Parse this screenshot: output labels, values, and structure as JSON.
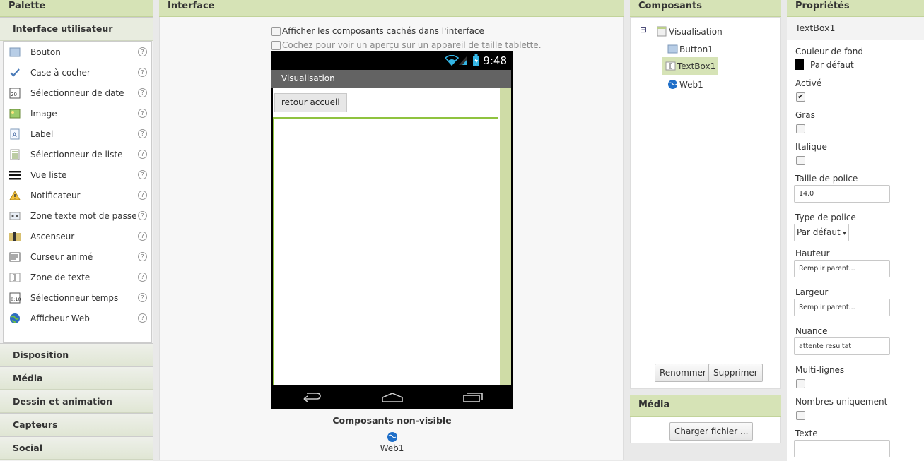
{
  "palette": {
    "title": "Palette",
    "open_section": "Interface utilisateur",
    "items": [
      {
        "label": "Bouton",
        "icon": "button-icon"
      },
      {
        "label": "Case à cocher",
        "icon": "checkbox-icon"
      },
      {
        "label": "Sélectionneur de date",
        "icon": "calendar-icon"
      },
      {
        "label": "Image",
        "icon": "image-icon"
      },
      {
        "label": "Label",
        "icon": "label-icon"
      },
      {
        "label": "Sélectionneur de liste",
        "icon": "list-picker-icon"
      },
      {
        "label": "Vue liste",
        "icon": "list-view-icon"
      },
      {
        "label": "Notificateur",
        "icon": "warning-icon"
      },
      {
        "label": "Zone texte mot de passe",
        "icon": "password-icon"
      },
      {
        "label": "Ascenseur",
        "icon": "slider-icon"
      },
      {
        "label": "Curseur animé",
        "icon": "spinner-icon"
      },
      {
        "label": "Zone de texte",
        "icon": "textbox-icon"
      },
      {
        "label": "Sélectionneur temps",
        "icon": "clock-icon"
      },
      {
        "label": "Afficheur Web",
        "icon": "globe-icon"
      }
    ],
    "help_glyph": "?",
    "sections": [
      "Disposition",
      "Média",
      "Dessin et animation",
      "Capteurs",
      "Social"
    ]
  },
  "interface": {
    "title": "Interface",
    "show_hidden": "Afficher les composants cachés dans l'interface",
    "tablet_preview": "Cochez pour voir un aperçu sur un appareil de taille tablette.",
    "phone": {
      "time": "9:48",
      "screen_title": "Visualisation",
      "button_text": "retour accueil"
    },
    "nonvisible_title": "Composants non-visible",
    "nonvisible_item": "Web1"
  },
  "components": {
    "title": "Composants",
    "tree": [
      {
        "label": "Visualisation",
        "icon": "screen-icon"
      },
      {
        "label": "Button1",
        "icon": "button-icon"
      },
      {
        "label": "TextBox1",
        "icon": "textbox-icon",
        "selected": true
      },
      {
        "label": "Web1",
        "icon": "globe-icon"
      }
    ],
    "collapse_glyph": "⊟",
    "rename": "Renommer",
    "delete": "Supprimer"
  },
  "media": {
    "title": "Média",
    "upload": "Charger fichier ..."
  },
  "properties": {
    "title": "Propriétés",
    "selected": "TextBox1",
    "bg_color_label": "Couleur de fond",
    "bg_color_value": "Par défaut",
    "bg_color_swatch": "#000000",
    "enabled_label": "Activé",
    "enabled": true,
    "bold_label": "Gras",
    "italic_label": "Italique",
    "font_size_label": "Taille de police",
    "font_size": "14.0",
    "font_type_label": "Type de police",
    "font_type": "Par défaut",
    "height_label": "Hauteur",
    "height": "Remplir parent...",
    "width_label": "Largeur",
    "width": "Remplir parent...",
    "hint_label": "Nuance",
    "hint": "attente resultat",
    "multiline_label": "Multi-lignes",
    "numbers_label": "Nombres uniquement",
    "text_label": "Texte",
    "text": ""
  },
  "colors": {
    "header_bg": "#d6e3b6",
    "accent_green": "#8fc33f"
  }
}
